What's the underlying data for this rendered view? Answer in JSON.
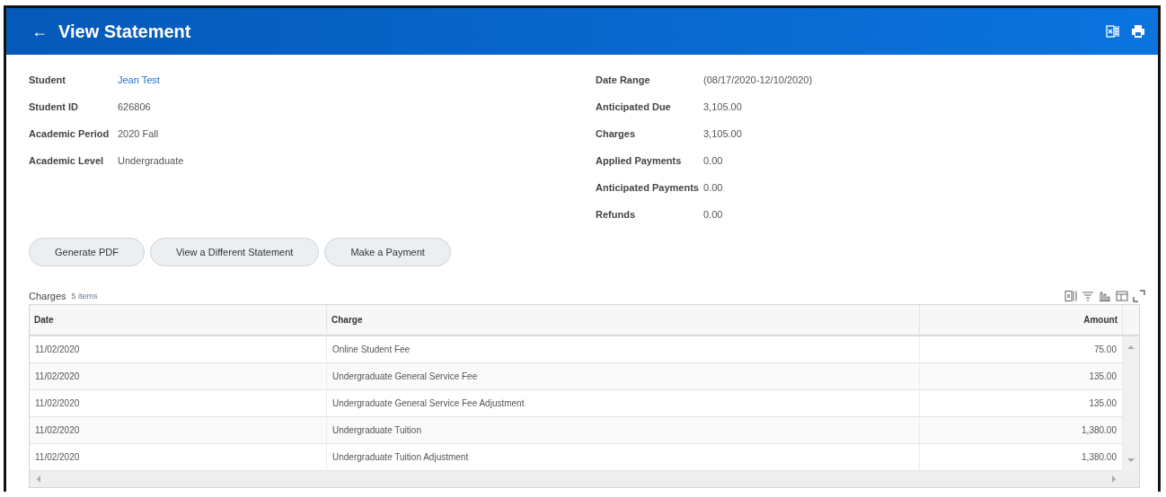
{
  "header": {
    "back": "←",
    "title": "View Statement"
  },
  "left_fields": [
    {
      "label": "Student",
      "value": "Jean Test",
      "kind": "link"
    },
    {
      "label": "Student ID",
      "value": "626806",
      "kind": "text"
    },
    {
      "label": "Academic Period",
      "value": "2020 Fall",
      "kind": "text"
    },
    {
      "label": "Academic Level",
      "value": "Undergraduate",
      "kind": "text"
    }
  ],
  "right_fields": [
    {
      "label": "Date Range",
      "value": "(08/17/2020-12/10/2020)"
    },
    {
      "label": "Anticipated Due",
      "value": "3,105.00"
    },
    {
      "label": "Charges",
      "value": "3,105.00"
    },
    {
      "label": "Applied Payments",
      "value": "0.00"
    },
    {
      "label": "Anticipated Payments",
      "value": "0.00"
    },
    {
      "label": "Refunds",
      "value": "0.00"
    }
  ],
  "buttons": [
    "Generate PDF",
    "View a Different Statement",
    "Make a Payment"
  ],
  "table": {
    "title": "Charges",
    "count": "5 items",
    "columns": [
      "Date",
      "Charge",
      "Amount"
    ],
    "rows": [
      [
        "11/02/2020",
        "Online Student Fee",
        "75.00"
      ],
      [
        "11/02/2020",
        "Undergraduate General Service Fee",
        "135.00"
      ],
      [
        "11/02/2020",
        "Undergraduate General Service Fee Adjustment",
        "135.00"
      ],
      [
        "11/02/2020",
        "Undergraduate Tuition",
        "1,380.00"
      ],
      [
        "11/02/2020",
        "Undergraduate Tuition Adjustment",
        "1,380.00"
      ]
    ]
  }
}
